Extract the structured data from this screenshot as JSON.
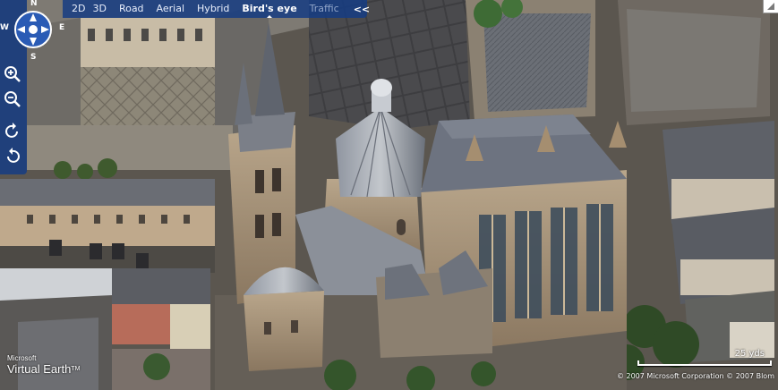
{
  "toolbar": {
    "items": [
      {
        "label": "2D"
      },
      {
        "label": "3D"
      },
      {
        "label": "Road"
      },
      {
        "label": "Aerial"
      },
      {
        "label": "Hybrid"
      },
      {
        "label": "Bird's eye"
      },
      {
        "label": "Traffic"
      }
    ],
    "active": "Bird's eye",
    "collapse_glyph": "<<"
  },
  "navigation": {
    "compass": {
      "north": "N",
      "south": "S",
      "east": "E",
      "west": "W"
    },
    "zoom_in_icon": "zoom-in-icon",
    "zoom_out_icon": "zoom-out-icon",
    "rotate_cw_icon": "rotate-clockwise-icon",
    "rotate_ccw_icon": "rotate-counterclockwise-icon"
  },
  "branding": {
    "line1": "Microsoft",
    "line2": "Virtual Earth",
    "tm": "TM"
  },
  "scale": {
    "label": "25 yds"
  },
  "copyright": {
    "text": "© 2007 Microsoft Corporation   © 2007 Blom"
  },
  "colors": {
    "toolbar_bg": "#163c82",
    "toolbar_text": "#e8eefb"
  }
}
